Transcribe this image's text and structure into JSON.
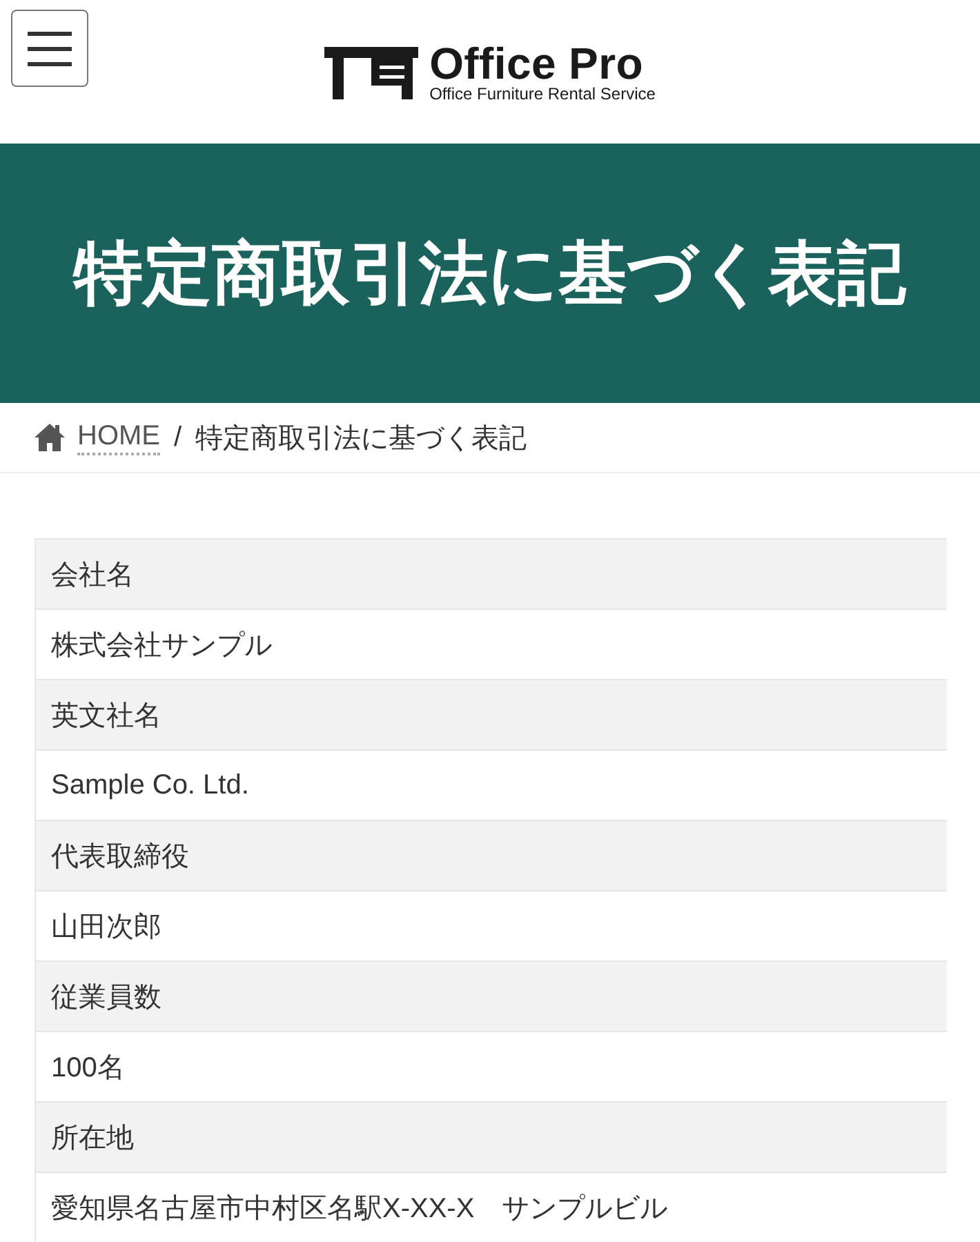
{
  "header": {
    "menu_button": {
      "kind": "hamburger"
    },
    "logo": {
      "name": "Office Pro",
      "tagline": "Office Furniture Rental Service"
    }
  },
  "page_title": "特定商取引法に基づく表記",
  "breadcrumb": {
    "separator": "/",
    "items": [
      {
        "kind": "home",
        "label": "HOME"
      },
      {
        "kind": "current",
        "label": "特定商取引法に基づく表記"
      }
    ]
  },
  "table": {
    "rows": [
      {
        "label": "会社名",
        "value": "株式会社サンプル"
      },
      {
        "label": "英文社名",
        "value": "Sample Co. Ltd."
      },
      {
        "label": "代表取締役",
        "value": "山田次郎"
      },
      {
        "label": "従業員数",
        "value": "100名"
      },
      {
        "label": "所在地",
        "value": "愛知県名古屋市中村区名駅X-XX-X　サンプルビル"
      }
    ]
  }
}
